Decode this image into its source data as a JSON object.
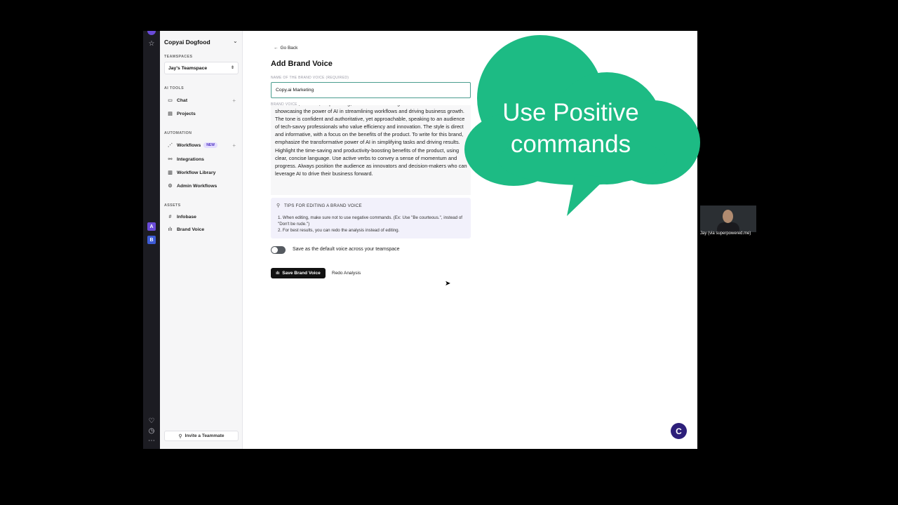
{
  "workspace": {
    "name": "Copyai Dogfood"
  },
  "sidebar": {
    "teamspaces_label": "TEAMSPACES",
    "teamspace": "Jay's Teamspace",
    "ai_tools_label": "AI TOOLS",
    "ai_tools": [
      {
        "label": "Chat"
      },
      {
        "label": "Projects"
      }
    ],
    "automation_label": "AUTOMATION",
    "automation": [
      {
        "label": "Workflows",
        "badge": "NEW"
      },
      {
        "label": "Integrations"
      },
      {
        "label": "Workflow Library"
      },
      {
        "label": "Admin Workflows"
      }
    ],
    "assets_label": "ASSETS",
    "assets": [
      {
        "label": "Infobase"
      },
      {
        "label": "Brand Voice"
      }
    ],
    "invite_label": "Invite a Teammate"
  },
  "main": {
    "go_back": "Go Back",
    "title": "Add Brand Voice",
    "name_label": "NAME OF THE BRAND VOICE (REQUIRED)",
    "name_value": "Copy.ai Marketing",
    "voice_label": "BRAND VOICE",
    "voice_text": "innovative, efficient, empowering, and forward-thinking. This brand voice is all about showcasing the power of AI in streamlining workflows and driving business growth. The tone is confident and authoritative, yet approachable, speaking to an audience of tech-savvy professionals who value efficiency and innovation. The style is direct and informative, with a focus on the benefits of the product. To write for this brand, emphasize the transformative power of AI in simplifying tasks and driving results. Highlight the time-saving and productivity-boosting benefits of the product, using clear, concise language. Use active verbs to convey a sense of momentum and progress. Always position the audience as innovators and decision-makers who can leverage AI to drive their business forward.",
    "tips_title": "TIPS FOR EDITING A BRAND VOICE",
    "tips": [
      "1. When editing, make sure not to use negative commands. (Ex: Use \"Be courteous.\", instead of \"Don't be rude.\")",
      "2. For best results, you can redo the analysis instead of editing."
    ],
    "default_toggle_label": "Save as the default voice across your teamspace",
    "default_toggle_on": false,
    "save_button": "Save Brand Voice",
    "redo_button": "Redo Analysis",
    "help_bubble": "C"
  },
  "overlay": {
    "cloud_text_line1": "Use Positive",
    "cloud_text_line2": "commands",
    "cloud_color": "#1dbb84"
  },
  "video": {
    "caption": "Jay (via superpowered.me)"
  },
  "colors": {
    "accent": "#2d1f7a",
    "input_border": "#4a9d8f",
    "badge_bg": "#e3dcff"
  }
}
